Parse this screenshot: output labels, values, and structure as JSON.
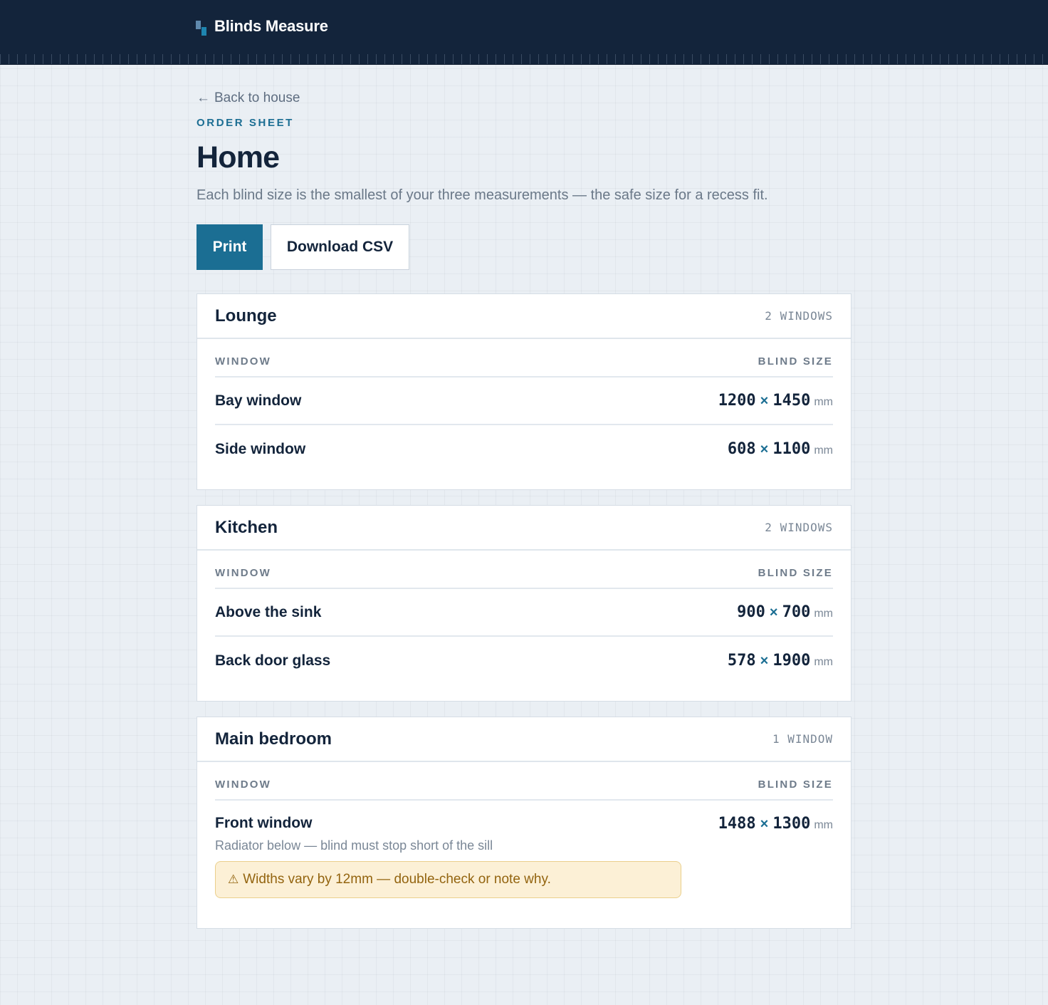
{
  "app": {
    "name": "Blinds Measure"
  },
  "nav": {
    "back_label": "Back to house",
    "back_icon": "left-arrow-icon"
  },
  "page": {
    "eyebrow": "ORDER SHEET",
    "title": "Home",
    "subtitle": "Each blind size is the smallest of your three measurements — the safe size for a recess fit."
  },
  "actions": {
    "print_label": "Print",
    "download_label": "Download CSV"
  },
  "table_headers": {
    "window": "WINDOW",
    "blind_size": "BLIND SIZE"
  },
  "units": {
    "separator": "×",
    "unit": "mm"
  },
  "rooms": [
    {
      "name": "Lounge",
      "count": "2 WINDOWS",
      "windows": [
        {
          "name": "Bay window",
          "width": "1200",
          "height": "1450"
        },
        {
          "name": "Side window",
          "width": "608",
          "height": "1100"
        }
      ]
    },
    {
      "name": "Kitchen",
      "count": "2 WINDOWS",
      "windows": [
        {
          "name": "Above the sink",
          "width": "900",
          "height": "700"
        },
        {
          "name": "Back door glass",
          "width": "578",
          "height": "1900"
        }
      ]
    },
    {
      "name": "Main bedroom",
      "count": "1 WINDOW",
      "windows": [
        {
          "name": "Front window",
          "width": "1488",
          "height": "1300",
          "note": "Radiator below — blind must stop short of the sill",
          "warning": "Widths vary by 12mm — double-check or note why."
        }
      ]
    }
  ],
  "colors": {
    "navy": "#13243b",
    "accent": "#1b6e93",
    "warning_bg": "#fcf0d6",
    "warning_text": "#93640f"
  }
}
